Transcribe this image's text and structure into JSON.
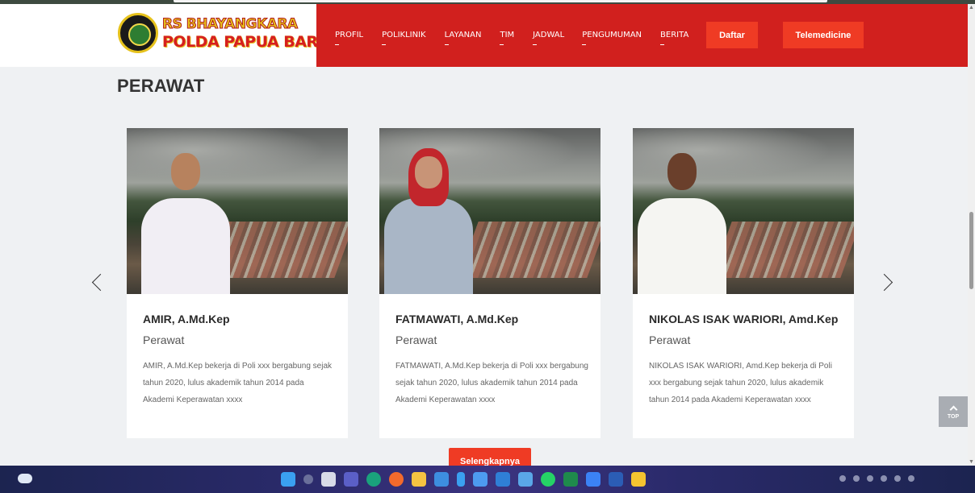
{
  "header": {
    "logo_line1": "RS BHAYANGKARA",
    "logo_line2": "POLDA PAPUA BARAT",
    "nav": [
      "PROFIL",
      "POLIKLINIK",
      "LAYANAN",
      "TIM",
      "JADWAL",
      "PENGUMUMAN",
      "BERITA"
    ],
    "daftar_label": "Daftar",
    "telemedicine_label": "Telemedicine"
  },
  "section": {
    "title": "PERAWAT",
    "cards": [
      {
        "name": "AMIR, A.Md.Kep",
        "role": "Perawat",
        "description": "AMIR, A.Md.Kep bekerja di Poli xxx bergabung sejak tahun 2020, lulus akademik tahun 2014 pada Akademi Keperawatan xxxx"
      },
      {
        "name": "FATMAWATI, A.Md.Kep",
        "role": "Perawat",
        "description": "FATMAWATI, A.Md.Kep bekerja di Poli xxx bergabung sejak tahun 2020, lulus akademik tahun 2014 pada Akademi Keperawatan xxxx"
      },
      {
        "name": "NIKOLAS ISAK WARIORI, Amd.Kep",
        "role": "Perawat",
        "description": "NIKOLAS ISAK WARIORI, Amd.Kep bekerja di Poli xxx bergabung sejak tahun 2020, lulus akademik tahun 2014 pada Akademi Keperawatan xxxx"
      }
    ],
    "more_label": "Selengkapnya"
  },
  "back_to_top_label": "TOP",
  "colors": {
    "header_red": "#d1201e",
    "button_orange": "#ef3b24",
    "background": "#eff1f3"
  },
  "icons": [
    "chevron-left-icon",
    "chevron-right-icon",
    "chevron-up-icon",
    "logo-emblem-icon"
  ]
}
